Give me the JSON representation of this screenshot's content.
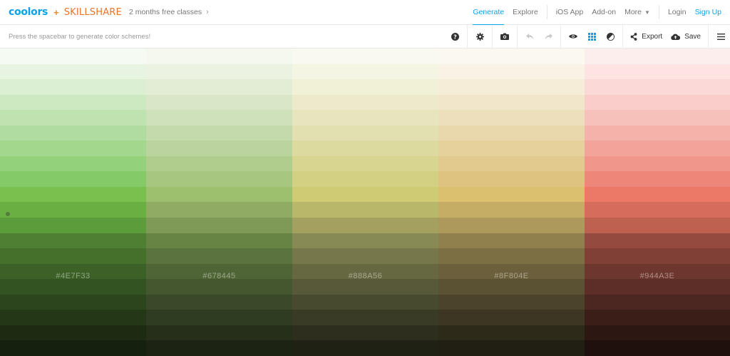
{
  "header": {
    "logo": "coolors",
    "plus": "+",
    "partner": "SKILLSHARE",
    "promo": "2 months free classes",
    "nav": [
      {
        "id": "generate",
        "label": "Generate",
        "active": true
      },
      {
        "id": "explore",
        "label": "Explore",
        "active": false
      }
    ],
    "nav2": [
      {
        "id": "ios-app",
        "label": "iOS App"
      },
      {
        "id": "add-on",
        "label": "Add-on"
      },
      {
        "id": "more",
        "label": "More"
      }
    ],
    "login": "Login",
    "signup": "Sign Up"
  },
  "toolbar": {
    "hint": "Press the spacebar to generate color schemes!",
    "export_label": "Export",
    "save_label": "Save"
  },
  "colors": {
    "accent": "#0ea1e6",
    "skillshare": "#e87425"
  },
  "palette": {
    "columns": [
      {
        "hex": "#4E7F33",
        "shades": [
          "#f5faf2",
          "#e8f4e2",
          "#dbefd2",
          "#cde9c1",
          "#bfe3b0",
          "#b0dd9f",
          "#a2d78d",
          "#93d17b",
          "#84ca68",
          "#7ac04f",
          "#6aaf42",
          "#5d9c3a",
          "#4E7F33",
          "#44702c",
          "#3c6127",
          "#345322",
          "#2c451d",
          "#243818",
          "#1d2b13",
          "#15200e"
        ]
      },
      {
        "hex": "#678445",
        "shades": [
          "#f4f8ee",
          "#ecf2e2",
          "#e3edd6",
          "#d9e7c8",
          "#cfe1ba",
          "#c5daac",
          "#bbd39d",
          "#b1cd8e",
          "#a7c67f",
          "#9dc06f",
          "#8fac62",
          "#7f9a57",
          "#678445",
          "#5b743d",
          "#506536",
          "#45572f",
          "#3a4928",
          "#303c21",
          "#262f1a",
          "#1c2313"
        ]
      },
      {
        "hex": "#888A56",
        "shades": [
          "#f9f9ef",
          "#f5f5e3",
          "#f1f1d7",
          "#eceacb",
          "#e7e5bd",
          "#e2e0b0",
          "#ddda9f",
          "#d8d590",
          "#d3d083",
          "#cecb74",
          "#b9b76a",
          "#a4a160",
          "#888A56",
          "#76784b",
          "#666841",
          "#575938",
          "#484a2f",
          "#3a3b26",
          "#2d2e1d",
          "#202115"
        ]
      },
      {
        "hex": "#8F804E",
        "shades": [
          "#fbf8f0",
          "#f8f3e4",
          "#f5edd7",
          "#f1e6c9",
          "#eddfbb",
          "#e9d8ac",
          "#e6d19c",
          "#e2ca8e",
          "#dec380",
          "#dbc070",
          "#c5ad66",
          "#ae995c",
          "#8F804E",
          "#7c6f44",
          "#6b603b",
          "#5b5233",
          "#4b442a",
          "#3c3622",
          "#2e2a1a",
          "#211e13"
        ]
      },
      {
        "hex": "#944A3E",
        "shades": [
          "#fdeeee",
          "#fde4e3",
          "#fbd9d7",
          "#f9cdca",
          "#f6c0bb",
          "#f4b2ab",
          "#f2a49b",
          "#f0968b",
          "#ee877a",
          "#ec7967",
          "#d66d5c",
          "#bf6151",
          "#944A3E",
          "#804036",
          "#6e372e",
          "#5d2e27",
          "#4c2620",
          "#3c1e19",
          "#2d1713",
          "#20100d"
        ]
      }
    ]
  }
}
